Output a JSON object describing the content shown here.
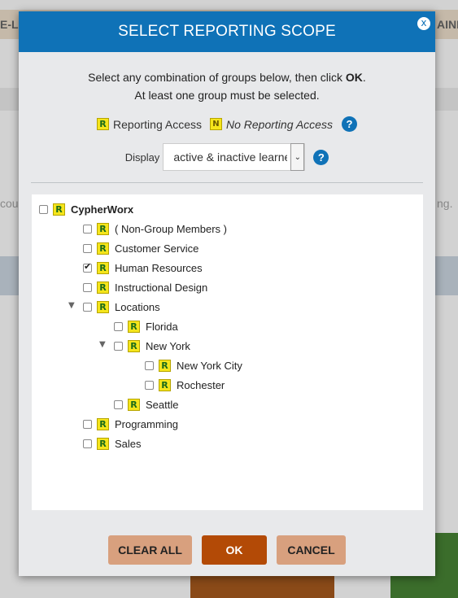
{
  "background": {
    "top_left_text": "E-LE",
    "top_right_text": "AINI",
    "left_text": "cou",
    "right_text": "ng."
  },
  "modal": {
    "title": "SELECT REPORTING SCOPE",
    "close_label": "x",
    "instructions_pre": "Select any combination of groups below, then click ",
    "instructions_bold": "OK",
    "instructions_post": ".",
    "instructions_line2": "At least one group must be selected.",
    "legend": {
      "r_glyph": "R",
      "reporting_label": "Reporting Access",
      "n_glyph": "N",
      "no_reporting_label": "No Reporting Access",
      "help_glyph": "?"
    },
    "display": {
      "label": "Display",
      "value": "active & inactive learners",
      "arrow": "⌄",
      "help_glyph": "?"
    },
    "tree": [
      {
        "label": "CypherWorx",
        "checked": false,
        "bold": true
      },
      {
        "label": "( Non-Group Members )",
        "checked": false
      },
      {
        "label": "Customer Service",
        "checked": false
      },
      {
        "label": "Human Resources",
        "checked": true
      },
      {
        "label": "Instructional Design",
        "checked": false
      },
      {
        "label": "Locations",
        "checked": false,
        "expanded": true
      },
      {
        "label": "Florida",
        "checked": false
      },
      {
        "label": "New York",
        "checked": false,
        "expanded": true
      },
      {
        "label": "New York City",
        "checked": false
      },
      {
        "label": "Rochester",
        "checked": false
      },
      {
        "label": "Seattle",
        "checked": false
      },
      {
        "label": "Programming",
        "checked": false
      },
      {
        "label": "Sales",
        "checked": false
      }
    ],
    "buttons": {
      "clear_all": "CLEAR ALL",
      "ok": "OK",
      "cancel": "CANCEL"
    },
    "colors": {
      "header": "#0f72b7",
      "ok_button": "#b34a06",
      "secondary_button": "#d8a07e"
    }
  }
}
